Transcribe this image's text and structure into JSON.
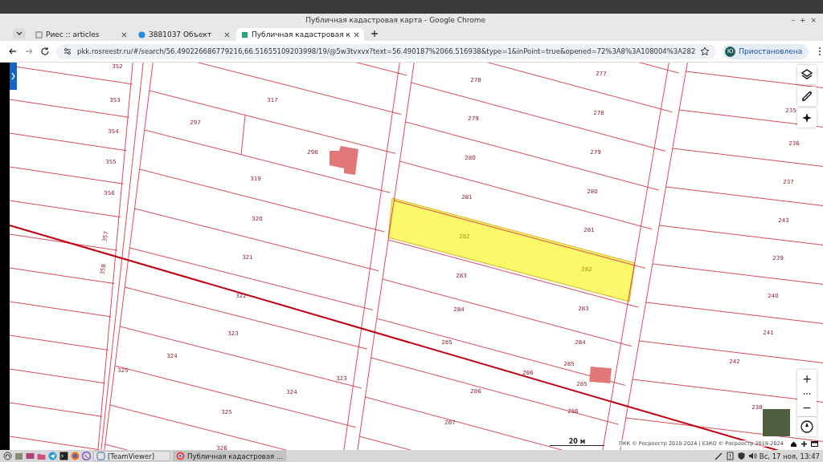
{
  "window": {
    "title": "Публичная кадастровая карта - Google Chrome",
    "controls": [
      "–",
      "+",
      "×"
    ]
  },
  "tabs": [
    {
      "label": "Риес :: articles",
      "selected": false
    },
    {
      "label": "3881037 Объект",
      "selected": false
    },
    {
      "label": "Публичная кадастровая к",
      "selected": true
    }
  ],
  "address_bar": {
    "url": "pkk.rosreestr.ru/#/search/56.490226686779216,66.51655109203998/19/@5w3tvxvx?text=56.490187%2066.516938&type=1&inPoint=true&opened=72%3A8%3A108004%3A282",
    "profile_initial": "Ю",
    "profile_label": "Приостановлена"
  },
  "map": {
    "parcel_labels": [
      "352",
      "353",
      "354",
      "355",
      "356",
      "357",
      "358",
      "317",
      "297",
      "298",
      "319",
      "320",
      "321",
      "322",
      "323",
      "324",
      "325",
      "323",
      "324",
      "325",
      "326",
      "278",
      "277",
      "279",
      "278",
      "280",
      "279",
      "281",
      "280",
      "282",
      "281",
      "283",
      "282",
      "284",
      "283",
      "285",
      "284",
      "286",
      "285",
      "286",
      "285",
      "287",
      "286",
      "235",
      "236",
      "237",
      "243",
      "239",
      "240",
      "241",
      "242",
      "238"
    ],
    "zoom_controls": [
      "+",
      "•••",
      "−"
    ],
    "scale": "20 м",
    "attribution": "ПКК © Росреестр 2010-2024 | ЕЗКО © Росреестр 2019-2024"
  },
  "taskbar": {
    "windows": [
      {
        "label": "[TeamViewer]",
        "selected": false
      },
      {
        "label": "Публичная кадастровая ...",
        "selected": true
      }
    ],
    "clock": "Вс, 17 ноя, 13:47"
  }
}
